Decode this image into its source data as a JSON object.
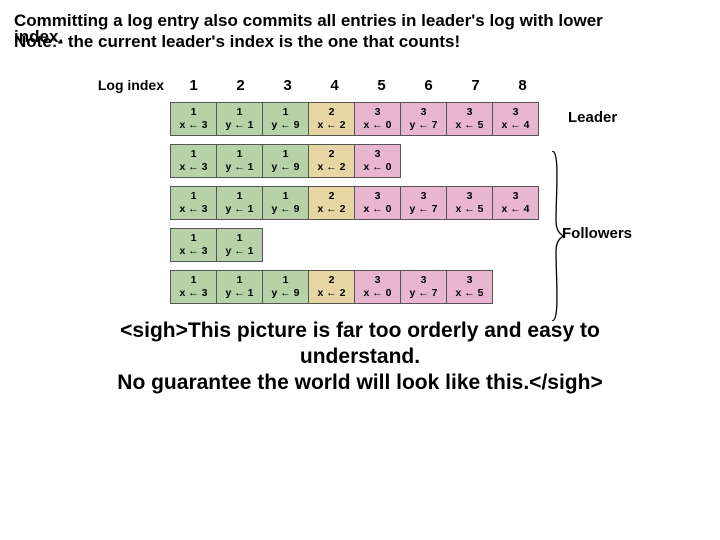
{
  "heading": {
    "main": "Committing a log entry also commits all entries in leader's log with lower",
    "word_index": "index.",
    "note": "Note:- the current leader's index is the one that counts!"
  },
  "index_label": "Log index",
  "indices": [
    "1",
    "2",
    "3",
    "4",
    "5",
    "6",
    "7",
    "8"
  ],
  "labels": {
    "leader": "Leader",
    "followers": "Followers"
  },
  "rows": [
    [
      {
        "t": "1",
        "c": "x ← 3"
      },
      {
        "t": "1",
        "c": "y ← 1"
      },
      {
        "t": "1",
        "c": "y ← 9"
      },
      {
        "t": "2",
        "c": "x ← 2"
      },
      {
        "t": "3",
        "c": "x ← 0"
      },
      {
        "t": "3",
        "c": "y ← 7"
      },
      {
        "t": "3",
        "c": "x ← 5"
      },
      {
        "t": "3",
        "c": "x ← 4"
      }
    ],
    [
      {
        "t": "1",
        "c": "x ← 3"
      },
      {
        "t": "1",
        "c": "y ← 1"
      },
      {
        "t": "1",
        "c": "y ← 9"
      },
      {
        "t": "2",
        "c": "x ← 2"
      },
      {
        "t": "3",
        "c": "x ← 0"
      }
    ],
    [
      {
        "t": "1",
        "c": "x ← 3"
      },
      {
        "t": "1",
        "c": "y ← 1"
      },
      {
        "t": "1",
        "c": "y ← 9"
      },
      {
        "t": "2",
        "c": "x ← 2"
      },
      {
        "t": "3",
        "c": "x ← 0"
      },
      {
        "t": "3",
        "c": "y ← 7"
      },
      {
        "t": "3",
        "c": "x ← 5"
      },
      {
        "t": "3",
        "c": "x ← 4"
      }
    ],
    [
      {
        "t": "1",
        "c": "x ← 3"
      },
      {
        "t": "1",
        "c": "y ← 1"
      }
    ],
    [
      {
        "t": "1",
        "c": "x ← 3"
      },
      {
        "t": "1",
        "c": "y ← 1"
      },
      {
        "t": "1",
        "c": "y ← 9"
      },
      {
        "t": "2",
        "c": "x ← 2"
      },
      {
        "t": "3",
        "c": "x ← 0"
      },
      {
        "t": "3",
        "c": "y ← 7"
      },
      {
        "t": "3",
        "c": "x ← 5"
      }
    ]
  ],
  "sigh": {
    "l1": "<sigh>This picture is far too orderly and easy to",
    "l2": "understand.",
    "l3": "No guarantee the world will look like this.</sigh>"
  }
}
